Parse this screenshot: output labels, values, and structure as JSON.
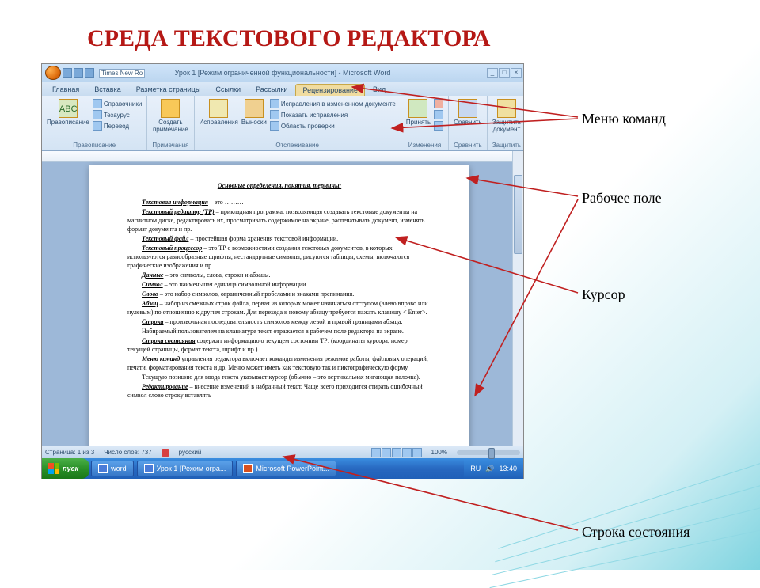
{
  "slide": {
    "title": "СРЕДА ТЕКСТОВОГО РЕДАКТОРА"
  },
  "annotations": {
    "menu": "Меню команд",
    "workarea": "Рабочее поле",
    "cursor": "Курсор",
    "statusbar": "Строка состояния"
  },
  "word": {
    "title": "Урок 1 [Режим ограниченной функциональности] - Microsoft Word",
    "font": "Times New Ro",
    "tabs": [
      "Главная",
      "Вставка",
      "Разметка страницы",
      "Ссылки",
      "Рассылки",
      "Рецензирование",
      "Вид"
    ],
    "ribbon_groups": {
      "g1": {
        "items": [
          "Правописание"
        ],
        "caption": "Правописание",
        "sub": [
          "Справочники",
          "Тезаурус",
          "Перевод"
        ]
      },
      "g2": {
        "items": [
          "Создать примечание"
        ],
        "caption": "Примечания"
      },
      "g3": {
        "items": [
          "Исправления",
          "Выноски"
        ],
        "caption": "Отслеживание",
        "sub": [
          "Исправления в измененном документе",
          "Показать исправления",
          "Область проверки"
        ]
      },
      "g4": {
        "items": [
          "Принять"
        ],
        "caption": "Изменения"
      },
      "g5": {
        "items": [
          "Сравнить"
        ],
        "caption": "Сравнить"
      },
      "g6": {
        "items": [
          "Защитить документ"
        ],
        "caption": "Защитить"
      }
    },
    "doc": {
      "heading": "Основные определения, понятия, термины:",
      "lines": [
        {
          "term": "Текстовая информация",
          "rest": " – это ………"
        },
        {
          "term": "Текстовый редактор (ТР)",
          "rest": " – прикладная программа, позволяющая создавать текстовые документы на магнитном диске, редактировать их, просматривать содержимое на экране, распечатывать документ, изменять формат документа и пр."
        },
        {
          "term": "Текстовый файл",
          "rest": " – простейшая форма хранения текстовой информации."
        },
        {
          "term": "Текстовый процессор",
          "rest": " – это ТР с возможностями создания текстовых документов, в которых используются разнообразные шрифты, нестандартные символы, рисуются таблицы, схемы, включаются графические изображения и пр."
        },
        {
          "term": "Данные",
          "rest": " – это символы, слова, строки и абзацы."
        },
        {
          "term": "Символ",
          "rest": " – это наименьшая единица символьной информации."
        },
        {
          "term": "Слово",
          "rest": " – это набор символов, ограниченный пробелами и знаками препинания."
        },
        {
          "term": "Абзац",
          "rest": " – набор из смежных строк файла, первая из которых может начинаться отступом (влево вправо или нулевым) по отношению к другим строкам. Для перехода к новому абзацу требуется нажать клавишу < Enter>."
        },
        {
          "term": "Строка",
          "rest": " – произвольная последовательность символов между левой и правой границами абзаца."
        },
        {
          "term": "",
          "rest": "Набираемый пользователем на клавиатуре текст отражается в рабочем поле редактора на экране."
        },
        {
          "term": "Строка состояния",
          "rest": " содержит информацию о текущем состоянии ТР: (координаты курсора, номер текущей страницы, формат текста, шрифт и пр.)"
        },
        {
          "term": "Меню команд",
          "rest": " управления редактора включает команды изменения режимов работы, файловых операций, печати, форматирования текста и др. Меню может иметь как текстовую так и пиктографическую форму."
        },
        {
          "term": "",
          "rest": "Текущую позицию для ввода текста указывает курсор (обычно – это вертикальная мигающая палочка)."
        },
        {
          "term": "Редактирование",
          "rest": " – внесение изменений в набранный текст. Чаще всего приходится стирать ошибочный символ слово строку вставлять"
        }
      ]
    },
    "status": {
      "page": "Страница: 1 из 3",
      "words": "Число слов: 737",
      "lang": "русский",
      "zoom": "100%"
    }
  },
  "taskbar": {
    "start": "пуск",
    "items": [
      "word",
      "Урок 1 [Режим огра...",
      "Microsoft PowerPoint..."
    ],
    "tray": {
      "lang": "RU",
      "time": "13:40"
    }
  }
}
